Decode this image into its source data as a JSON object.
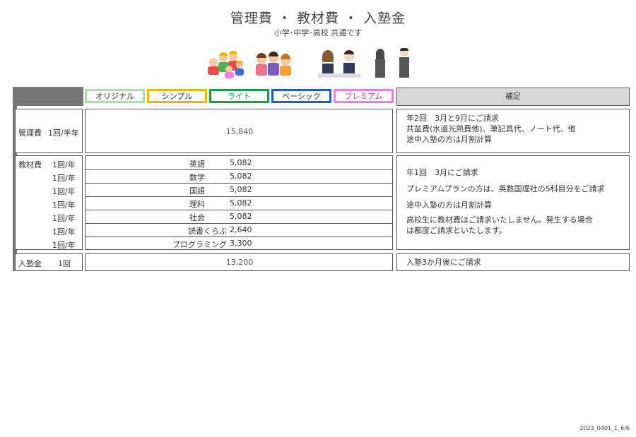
{
  "header": {
    "title": "管理費 ・ 教材費 ・ 入塾金",
    "subtitle": "小学･中学･高校 共通です"
  },
  "plans": [
    {
      "label": "オリジナル",
      "color": "#a8e0a8"
    },
    {
      "label": "シンプル",
      "color": "#f5b400"
    },
    {
      "label": "ライト",
      "color": "#19a040"
    },
    {
      "label": "ベーシック",
      "color": "#1a5fd6"
    },
    {
      "label": "プレミアム",
      "color": "#f07ee8"
    }
  ],
  "hosoku_header": "補足",
  "kanrihi": {
    "label": "管理費",
    "freq": "1回/半年",
    "value": "15,840",
    "notes": [
      "年2回　3月と9月にご請求",
      "共益費(水道光熱費他)、筆記具代、ノート代、他",
      "途中入塾の方は月割計算"
    ]
  },
  "kyozaihi": {
    "label": "教材費",
    "rows": [
      {
        "freq": "1回/年",
        "subject": "英語",
        "value": "5,082"
      },
      {
        "freq": "1回/年",
        "subject": "数学",
        "value": "5,082"
      },
      {
        "freq": "1回/年",
        "subject": "国語",
        "value": "5,082"
      },
      {
        "freq": "1回/年",
        "subject": "理科",
        "value": "5,082"
      },
      {
        "freq": "1回/年",
        "subject": "社会",
        "value": "5,082"
      },
      {
        "freq": "1回/年",
        "subject": "読書くらぶ",
        "value": "2,640"
      },
      {
        "freq": "1回/年",
        "subject": "プログラミング",
        "value": "3,300"
      }
    ],
    "notes": [
      "年1回　3月にご請求",
      "プレミアムプランの方は、英数国理社の5科目分をご請求",
      "途中入塾の方は月割計算",
      "高校生に教材費はご請求いたしません。発生する場合",
      "は都度ご請求といたします。"
    ]
  },
  "nyujukin": {
    "label": "入塾金",
    "freq": "1回",
    "value": "13,200",
    "note": "入塾3か月後にご請求"
  },
  "footer": "2023_0401_1_6/6"
}
